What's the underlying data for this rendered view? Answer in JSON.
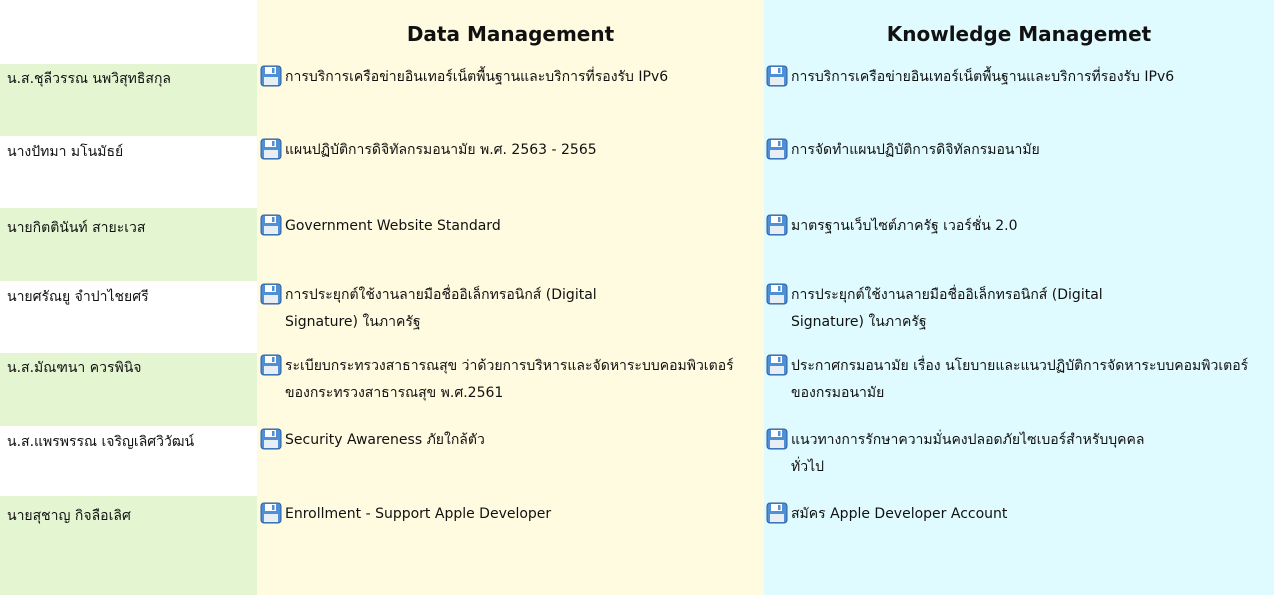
{
  "headers": {
    "data_management": "Data Management",
    "knowledge_management": "Knowledge Managemet"
  },
  "colors": {
    "name_highlight": "#e4f5d2",
    "data_management_bg": "#fffbe0",
    "knowledge_management_bg": "#e0fbff"
  },
  "icon": "floppy-disk-icon",
  "rows": [
    {
      "name": "น.ส.ชุลีวรรณ นพวิสุทธิสกุล",
      "dm": "การบริการเครือข่ายอินเทอร์เน็ตพื้นฐานและบริการที่รองรับ IPv6",
      "km": "การบริการเครือข่ายอินเทอร์เน็ตพื้นฐานและบริการที่รองรับ IPv6"
    },
    {
      "name": "นางปัทมา มโนมัธย์",
      "dm": "แผนปฏิบัติการดิจิทัลกรมอนามัย พ.ศ. 2563 - 2565",
      "km": "การจัดทำแผนปฏิบัติการดิจิทัลกรมอนามัย"
    },
    {
      "name": "นายกิตตินันท์ สายะเวส",
      "dm": "Government Website Standard",
      "km": "มาตรฐานเว็บไซต์ภาครัฐ เวอร์ชั่น 2.0"
    },
    {
      "name": "นายศรัณยู จำปาไชยศรี",
      "dm": "การประยุกต์ใช้งานลายมือชื่ออิเล็กทรอนิกส์ (Digital Signature) ในภาครัฐ",
      "km": "การประยุกต์ใช้งานลายมือชื่ออิเล็กทรอนิกส์ (Digital Signature) ในภาครัฐ"
    },
    {
      "name": "น.ส.มัณฑนา ควรพินิจ",
      "dm": "ระเบียบกระทรวงสาธารณสุข ว่าด้วยการบริหารและจัดหาระบบคอมพิวเตอร์ ของกระทรวงสาธารณสุข พ.ศ.2561",
      "km": "ประกาศกรมอนามัย เรื่อง นโยบายและแนวปฏิบัติการจัดหาระบบคอมพิวเตอร์ของกรมอนามัย"
    },
    {
      "name": "น.ส.แพรพรรณ เจริญเลิศวิวัฒน์",
      "dm": "Security Awareness ภัยใกล้ตัว",
      "km": "แนวทางการรักษาความมั่นคงปลอดภัยไซเบอร์สำหรับบุคคลทั่วไป"
    },
    {
      "name": "นายสุชาญ กิจลือเลิศ",
      "dm": "Enrollment - Support Apple Developer",
      "km": "สมัคร Apple Developer Account"
    }
  ]
}
